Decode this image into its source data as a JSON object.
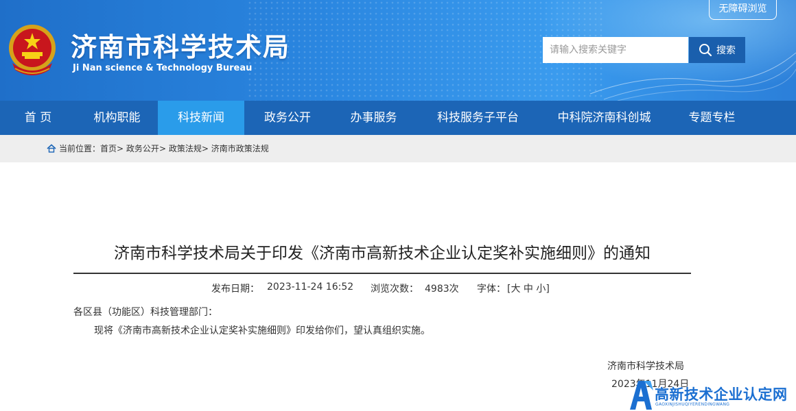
{
  "header": {
    "site_title": "济南市科学技术局",
    "site_subtitle": "Ji Nan science & Technology Bureau",
    "accessibility_label": "无障碍浏览",
    "search_placeholder": "请输入搜索关键字",
    "search_button_label": "搜索",
    "colors": {
      "header_bg": "#2a86e0",
      "nav_bg": "#1c65b6",
      "nav_active": "#2a9cea",
      "search_btn": "#1a5fad"
    }
  },
  "nav": {
    "items": [
      {
        "label": "首 页"
      },
      {
        "label": "机构职能"
      },
      {
        "label": "科技新闻",
        "active": true
      },
      {
        "label": "政务公开"
      },
      {
        "label": "办事服务"
      },
      {
        "label": "科技服务子平台"
      },
      {
        "label": "中科院济南科创城"
      },
      {
        "label": "专题专栏"
      }
    ]
  },
  "breadcrumb": {
    "prefix": "当前位置：",
    "items": [
      "首页",
      "政务公开",
      "政策法规",
      "济南市政策法规"
    ],
    "separator": ">"
  },
  "article": {
    "title": "济南市科学技术局关于印发《济南市高新技术企业认定奖补实施细则》的通知",
    "publish_label": "发布日期：",
    "publish_value": "2023-11-24 16:52",
    "views_label": "浏览次数：",
    "views_value": "4983次",
    "font_label": "字体：",
    "font_open": "[",
    "font_large": "大",
    "font_medium": "中",
    "font_small": "小",
    "font_close": "]",
    "salutation": "各区县（功能区）科技管理部门：",
    "body": "现将《济南市高新技术企业认定奖补实施细则》印发给你们，望认真组织实施。",
    "signature_org": "济南市科学技术局",
    "signature_date": "2023年11月24日"
  },
  "watermark": {
    "main": "高新技术企业认定网",
    "sub": "GAOXINJISHUQIYERENDINGWANG"
  }
}
